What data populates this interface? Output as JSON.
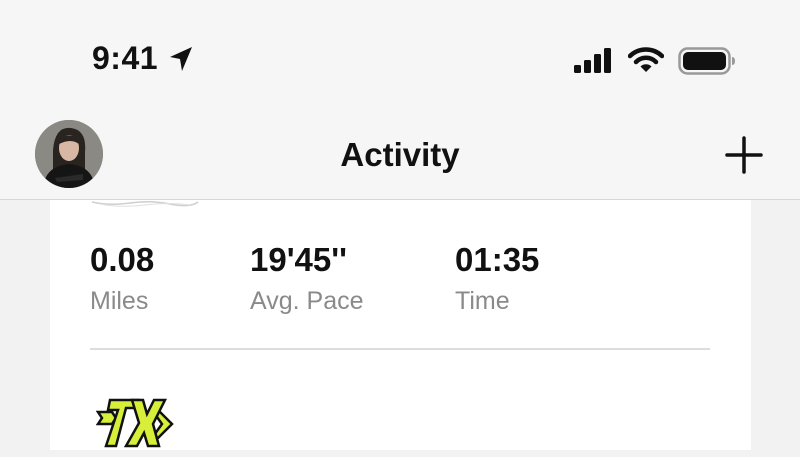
{
  "status_bar": {
    "time": "9:41",
    "location_icon": "location-arrow-icon",
    "signal_icon": "cellular-signal-icon",
    "wifi_icon": "wifi-icon",
    "battery_icon": "battery-icon"
  },
  "header": {
    "title": "Activity",
    "avatar": "profile-avatar",
    "add_icon": "plus-icon"
  },
  "activity": {
    "stats": [
      {
        "value": "0.08",
        "label": "Miles"
      },
      {
        "value": "19'45''",
        "label": "Avg. Pace"
      },
      {
        "value": "01:35",
        "label": "Time"
      }
    ],
    "badge_icon": "achievement-7x-badge-icon"
  },
  "colors": {
    "background": "#f2f2f2",
    "card": "#ffffff",
    "text": "#111111",
    "muted": "#8a8a8a",
    "badge_yellow": "#d8ef3a"
  }
}
